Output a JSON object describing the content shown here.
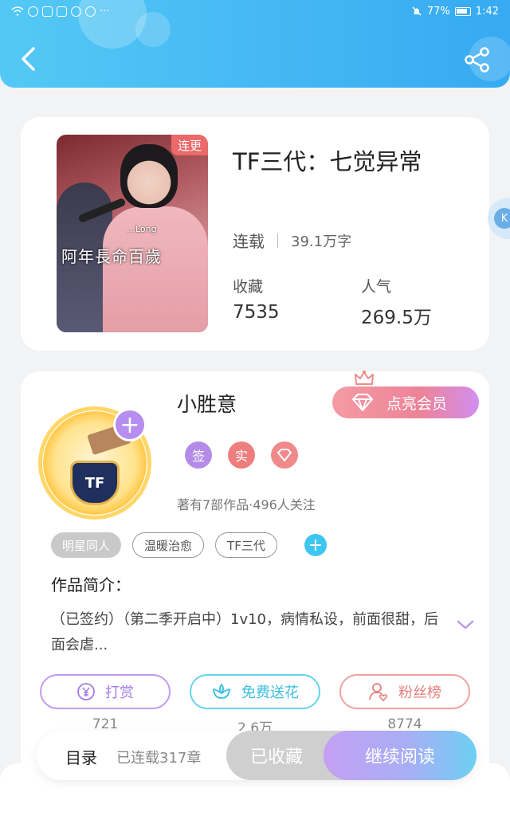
{
  "status_bar": {
    "battery": "77%",
    "time": "1:42",
    "more": "···"
  },
  "header": {
    "back_icon": "chevron-left-icon",
    "share_icon": "share-icon"
  },
  "book": {
    "title": "TF三代：七觉异常",
    "badge": "连更",
    "cover_text": "阿年長命百歲",
    "cover_small": "…Long",
    "status": "连载",
    "word_count": "39.1万字",
    "stats": [
      {
        "label": "收藏",
        "value": "7535"
      },
      {
        "label": "人气",
        "value": "269.5万"
      }
    ]
  },
  "author": {
    "name": "小胜意",
    "vip_label": "点亮会员",
    "badges": [
      {
        "text": "签",
        "color": "#b48ce8"
      },
      {
        "text": "实",
        "color": "#ee7d7d"
      },
      {
        "text": "◇",
        "color": "#f08a8a"
      }
    ],
    "avatar_badge_text": "TF",
    "meta": "著有7部作品·496人关注",
    "tags": [
      "明星同人",
      "温暖治愈",
      "TF三代"
    ]
  },
  "intro": {
    "title": "作品简介：",
    "text": "（已签约）（第二季开启中）1v10，病情私设，前面很甜，后面会虐..."
  },
  "actions": [
    {
      "label": "打赏",
      "count": "721",
      "icon": "yen-icon"
    },
    {
      "label": "免费送花",
      "count": "2.6万",
      "icon": "flower-icon"
    },
    {
      "label": "粉丝榜",
      "count": "8774",
      "icon": "user-heart-icon"
    }
  ],
  "bottom_bar": {
    "toc": "目录",
    "chapters": "已连载317章",
    "collected": "已收藏",
    "continue": "继续阅读"
  },
  "colors": {
    "header": "#43b6f3",
    "accent_purple": "#b68ef0",
    "accent_pink": "#ec8398",
    "accent_cyan": "#39bde2"
  }
}
